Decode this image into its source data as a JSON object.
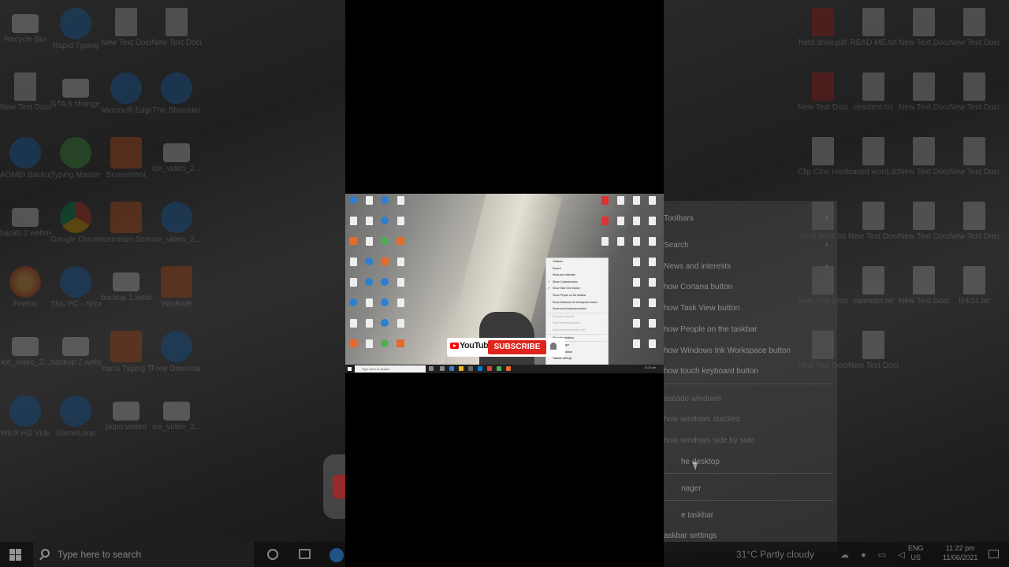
{
  "left_desktop_icons": [
    {
      "label": "Recycle Bin",
      "kind": "recycle"
    },
    {
      "label": "Rapid Typing",
      "kind": "blue"
    },
    {
      "label": "New Text Docume...",
      "kind": "doc"
    },
    {
      "label": "New Text Docume...",
      "kind": "doc"
    },
    {
      "label": "New Text Docume...",
      "kind": "doc"
    },
    {
      "label": "GTA 5 change.wmv",
      "kind": "white"
    },
    {
      "label": "Microsoft Edge",
      "kind": "blue"
    },
    {
      "label": "The Shredder",
      "kind": "blue"
    },
    {
      "label": "AOMEI Backupper",
      "kind": "blue"
    },
    {
      "label": "Typing Master 10",
      "kind": "green"
    },
    {
      "label": "Screenshot",
      "kind": "orange"
    },
    {
      "label": "ice_video_2...",
      "kind": "white"
    },
    {
      "label": "back0 2.webm",
      "kind": "white"
    },
    {
      "label": "Google Chrome",
      "kind": "chrome"
    },
    {
      "label": "Icecream Screen...",
      "kind": "orange"
    },
    {
      "label": "ice_video_2...",
      "kind": "blue"
    },
    {
      "label": "Firefox",
      "kind": "firefox"
    },
    {
      "label": "This PC - Shortcut",
      "kind": "blue"
    },
    {
      "label": "backup 1.webm",
      "kind": "white"
    },
    {
      "label": "WinRAR",
      "kind": "orange"
    },
    {
      "label": "Ice_video_2...",
      "kind": "white"
    },
    {
      "label": "backup 2.webm",
      "kind": "white"
    },
    {
      "label": "Iran's Typing Tutor",
      "kind": "orange"
    },
    {
      "label": "Free Downloa...",
      "kind": "blue"
    },
    {
      "label": "WinX HD Video C...",
      "kind": "blue"
    },
    {
      "label": "GameLoop",
      "kind": "blue"
    },
    {
      "label": "popo.webm",
      "kind": "white"
    },
    {
      "label": "ice_video_2...",
      "kind": "white"
    }
  ],
  "right_desktop_icons": [
    {
      "label": "hard drive.pdf",
      "kind": "pdf"
    },
    {
      "label": "READ ME.txt",
      "kind": "doc"
    },
    {
      "label": "New Text Docume...",
      "kind": "doc"
    },
    {
      "label": "New Text Docume...",
      "kind": "doc"
    },
    {
      "label": "New Text Docume...",
      "kind": "pdf"
    },
    {
      "label": "resident.txt",
      "kind": "doc"
    },
    {
      "label": "New Text Docume...",
      "kind": "doc"
    },
    {
      "label": "New Text Docume...",
      "kind": "doc"
    },
    {
      "label": "Clip Cloo Hoots.txt",
      "kind": "doc"
    },
    {
      "label": "saved word.docx",
      "kind": "doc"
    },
    {
      "label": "New Text Docume...",
      "kind": "doc"
    },
    {
      "label": "New Text Docume...",
      "kind": "doc"
    },
    {
      "label": "hard drive.txt",
      "kind": "doc"
    },
    {
      "label": "New Text Docume...",
      "kind": "doc"
    },
    {
      "label": "New Text Docume...",
      "kind": "doc"
    },
    {
      "label": "New Text Document.txt",
      "kind": "doc"
    },
    {
      "label": "New Text Docume...",
      "kind": "doc"
    },
    {
      "label": "calender.txt",
      "kind": "doc"
    },
    {
      "label": "New Text Docume...",
      "kind": "doc"
    },
    {
      "label": "link1s.txt",
      "kind": "doc"
    },
    {
      "label": "New Text Docume...",
      "kind": "doc"
    },
    {
      "label": "New Text Docume...",
      "kind": "doc"
    }
  ],
  "context_menu": {
    "items": [
      {
        "label": "Toolbars",
        "arrow": true,
        "disabled": false
      },
      {
        "label": "Search",
        "arrow": true,
        "disabled": false
      },
      {
        "label": "News and interests",
        "arrow": true,
        "disabled": false
      },
      {
        "label": "Show Cortana button",
        "arrow": false,
        "disabled": false
      },
      {
        "label": "Show Task View button",
        "arrow": false,
        "disabled": false
      },
      {
        "label": "Show People on the taskbar",
        "arrow": false,
        "disabled": false
      },
      {
        "label": "Show Windows Ink Workspace button",
        "arrow": false,
        "disabled": false
      },
      {
        "label": "Show touch keyboard button",
        "arrow": false,
        "disabled": false
      },
      {
        "label": "Cascade windows",
        "arrow": false,
        "disabled": true
      },
      {
        "label": "Show windows stacked",
        "arrow": false,
        "disabled": true
      },
      {
        "label": "Show windows side by side",
        "arrow": false,
        "disabled": true
      },
      {
        "label": "Show the desktop",
        "arrow": false,
        "disabled": false
      },
      {
        "label": "Task Manager",
        "arrow": false,
        "disabled": false
      },
      {
        "label": "Lock the taskbar",
        "arrow": false,
        "disabled": false
      },
      {
        "label": "Taskbar settings",
        "arrow": false,
        "disabled": false
      }
    ],
    "visible_texts": [
      "Toolbars",
      "Search",
      "News and interests",
      "how Cortana button",
      "how Task View button",
      "how People on the taskbar",
      "how Windows Ink Workspace button",
      "how touch keyboard button",
      "ascade windows",
      "how windows stacked",
      "how windows side by side",
      "he desktop",
      "nager",
      "e taskbar",
      "askbar settings"
    ]
  },
  "taskbar": {
    "search_placeholder": "Type here to search",
    "weather": "31°C  Partly cloudy",
    "language": "ENG",
    "region": "US",
    "time": "11:22 pm",
    "date": "11/06/2021"
  },
  "video_overlay": {
    "youtube_brand": "YouTube",
    "subscribe_label": "SUBSCRIBE"
  },
  "mini_menu": {
    "items": [
      "Toolbars",
      "Search",
      "News and interests",
      "Show Cortana button",
      "Show Task View button",
      "Show People on the taskbar",
      "Show Windows Ink Workspace button",
      "Show touch keyboard button",
      "Cascade windows",
      "Show windows stacked",
      "Show windows side by side",
      "Show the desktop",
      "Task Manager",
      "Lock the taskbar",
      "Taskbar settings"
    ],
    "search_placeholder": "Type here to search"
  }
}
